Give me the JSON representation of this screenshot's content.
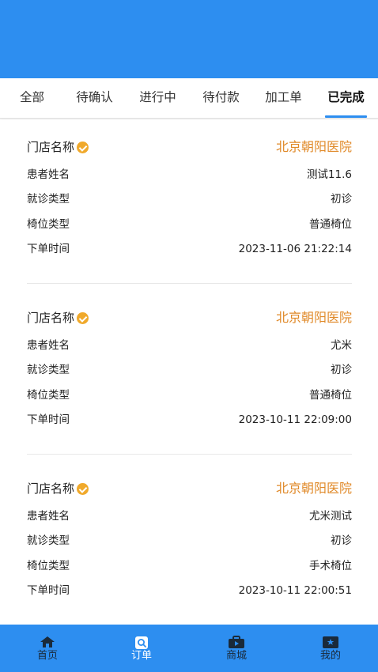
{
  "tabs": [
    {
      "label": "全部"
    },
    {
      "label": "待确认"
    },
    {
      "label": "进行中"
    },
    {
      "label": "待付款"
    },
    {
      "label": "加工单"
    },
    {
      "label": "已完成",
      "active": true
    }
  ],
  "orders": [
    {
      "store_label": "门店名称",
      "store_value": "北京朝阳医院",
      "patient_label": "患者姓名",
      "patient_value": "测试11.6",
      "visit_label": "就诊类型",
      "visit_value": "初诊",
      "chair_label": "椅位类型",
      "chair_value": "普通椅位",
      "time_label": "下单时间",
      "time_value": "2023-11-06 21:22:14"
    },
    {
      "store_label": "门店名称",
      "store_value": "北京朝阳医院",
      "patient_label": "患者姓名",
      "patient_value": "尤米",
      "visit_label": "就诊类型",
      "visit_value": "初诊",
      "chair_label": "椅位类型",
      "chair_value": "普通椅位",
      "time_label": "下单时间",
      "time_value": "2023-10-11 22:09:00"
    },
    {
      "store_label": "门店名称",
      "store_value": "北京朝阳医院",
      "patient_label": "患者姓名",
      "patient_value": "尤米测试",
      "visit_label": "就诊类型",
      "visit_value": "初诊",
      "chair_label": "椅位类型",
      "chair_value": "手术椅位",
      "time_label": "下单时间",
      "time_value": "2023-10-11 22:00:51"
    }
  ],
  "bottom_nav": [
    {
      "label": "首页",
      "icon": "home-icon"
    },
    {
      "label": "订单",
      "icon": "order-search-icon",
      "active": true
    },
    {
      "label": "商城",
      "icon": "shop-bag-icon"
    },
    {
      "label": "我的",
      "icon": "profile-card-icon"
    }
  ],
  "colors": {
    "primary": "#2d8ef0",
    "store_name": "#e08a2a",
    "verified_badge": "#f0a92b"
  }
}
